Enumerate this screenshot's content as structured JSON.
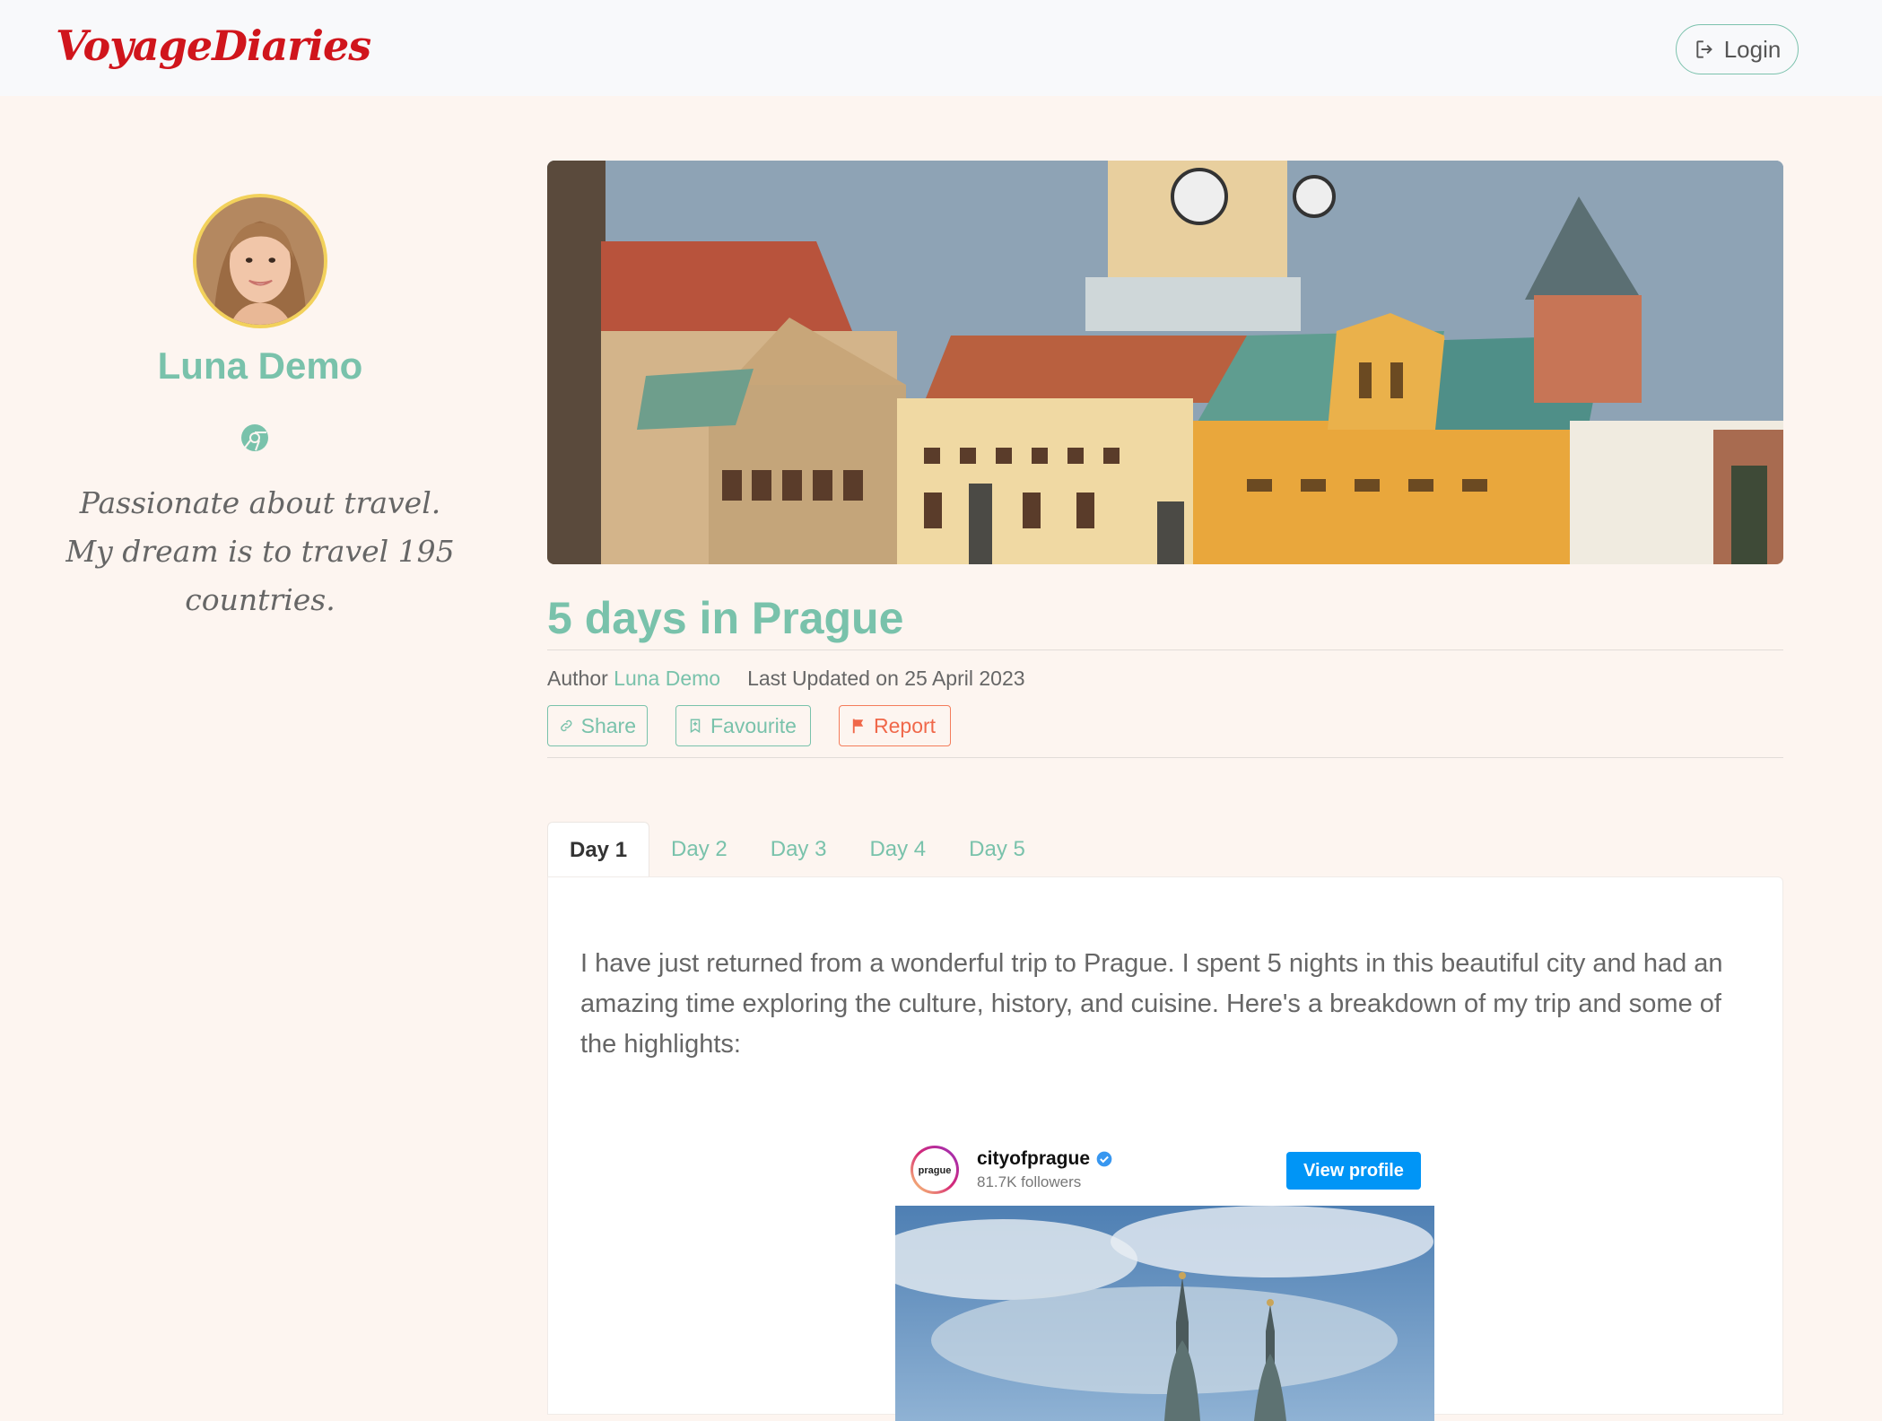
{
  "navbar": {
    "logo": "VoyageDiaries",
    "login_label": "Login"
  },
  "profile": {
    "name": "Luna Demo",
    "bio": "Passionate about travel. My dream is to travel 195 countries."
  },
  "post": {
    "title": "5 days in Prague",
    "author_label": "Author",
    "author_name": "Luna Demo",
    "updated": "Last Updated on 25 April 2023",
    "actions": {
      "share": "Share",
      "favourite": "Favourite",
      "report": "Report"
    },
    "tabs": [
      "Day 1",
      "Day 2",
      "Day 3",
      "Day 4",
      "Day 5"
    ],
    "active_tab": "Day 1",
    "intro": "I have just returned from a wonderful trip to Prague. I spent 5 nights in this beautiful city and had an amazing time exploring the culture, history, and cuisine. Here's a breakdown of my trip and some of the highlights:"
  },
  "embed": {
    "username": "cityofprague",
    "avatar_text": "prague",
    "followers": "81.7K followers",
    "view_profile": "View profile"
  },
  "colors": {
    "brand_red": "#d0151c",
    "accent_teal": "#79c2ab",
    "report_orange": "#f0684a",
    "page_bg": "#fdf5f0",
    "ig_blue": "#0095f6"
  }
}
